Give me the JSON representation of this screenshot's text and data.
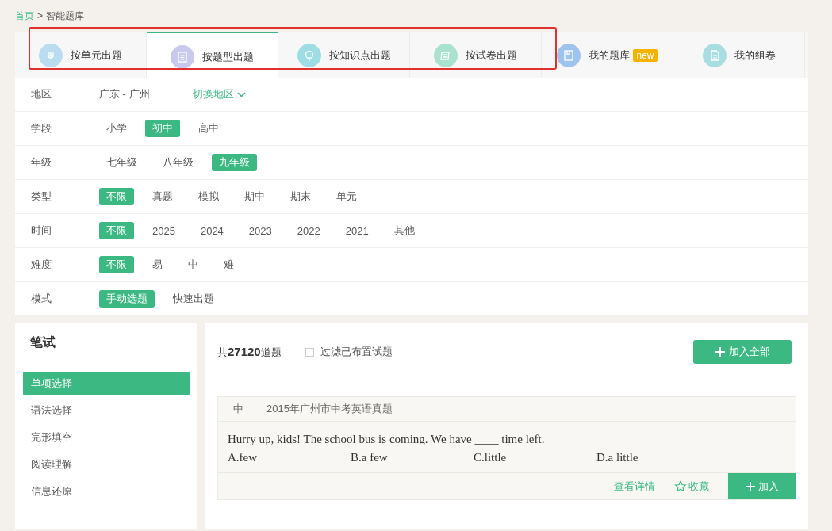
{
  "breadcrumb": {
    "home": "首页",
    "separator": ">",
    "current": "智能题库"
  },
  "tabs": [
    {
      "label": "按单元出题",
      "selected": false,
      "highlighted": true,
      "color": "#b9dcef"
    },
    {
      "label": "按题型出题",
      "selected": true,
      "highlighted": true,
      "color": "#c9c9ef"
    },
    {
      "label": "按知识点出题",
      "selected": false,
      "highlighted": true,
      "color": "#9fdde6"
    },
    {
      "label": "按试卷出题",
      "selected": false,
      "highlighted": true,
      "color": "#a9e3d0"
    },
    {
      "label": "我的题库",
      "selected": false,
      "highlighted": false,
      "color": "#9fc3ef",
      "badge": "new"
    },
    {
      "label": "我的组卷",
      "selected": false,
      "highlighted": false,
      "color": "#a8dde2"
    }
  ],
  "region": {
    "label": "地区",
    "value": "广东 - 广州",
    "switch_link": "切换地区"
  },
  "filters": [
    {
      "label": "学段",
      "options": [
        {
          "text": "小学",
          "selected": false
        },
        {
          "text": "初中",
          "selected": true
        },
        {
          "text": "高中",
          "selected": false
        }
      ]
    },
    {
      "label": "年级",
      "options": [
        {
          "text": "七年级",
          "selected": false
        },
        {
          "text": "八年级",
          "selected": false
        },
        {
          "text": "九年级",
          "selected": true
        }
      ]
    },
    {
      "label": "类型",
      "options": [
        {
          "text": "不限",
          "selected": true
        },
        {
          "text": "真题",
          "selected": false
        },
        {
          "text": "模拟",
          "selected": false
        },
        {
          "text": "期中",
          "selected": false
        },
        {
          "text": "期末",
          "selected": false
        },
        {
          "text": "单元",
          "selected": false
        }
      ]
    },
    {
      "label": "时间",
      "options": [
        {
          "text": "不限",
          "selected": true
        },
        {
          "text": "2025",
          "selected": false
        },
        {
          "text": "2024",
          "selected": false
        },
        {
          "text": "2023",
          "selected": false
        },
        {
          "text": "2022",
          "selected": false
        },
        {
          "text": "2021",
          "selected": false
        },
        {
          "text": "其他",
          "selected": false
        }
      ]
    },
    {
      "label": "难度",
      "options": [
        {
          "text": "不限",
          "selected": true
        },
        {
          "text": "易",
          "selected": false
        },
        {
          "text": "中",
          "selected": false
        },
        {
          "text": "难",
          "selected": false
        }
      ]
    },
    {
      "label": "模式",
      "options": [
        {
          "text": "手动选题",
          "selected": true
        },
        {
          "text": "快速出题",
          "selected": false
        }
      ]
    }
  ],
  "sidebar": {
    "title": "笔试",
    "items": [
      {
        "label": "单项选择",
        "selected": true
      },
      {
        "label": "语法选择",
        "selected": false
      },
      {
        "label": "完形填空",
        "selected": false
      },
      {
        "label": "阅读理解",
        "selected": false
      },
      {
        "label": "信息还原",
        "selected": false
      }
    ]
  },
  "results": {
    "count_prefix": "共",
    "count": "27120",
    "count_suffix": "道题",
    "filter_checkbox": {
      "label": "过滤已布置试题",
      "checked": false
    },
    "add_all_button": "加入全部"
  },
  "questions": [
    {
      "difficulty": "中",
      "source": "2015年广州市中考英语真题",
      "text": "Hurry up, kids! The school bus is coming. We have ____ time left.",
      "options": [
        "A.few",
        "B.a few",
        "C.little",
        "D.a little"
      ],
      "details_link": "查看详情",
      "favorite_link": "收藏",
      "add_button": "加入"
    }
  ]
}
